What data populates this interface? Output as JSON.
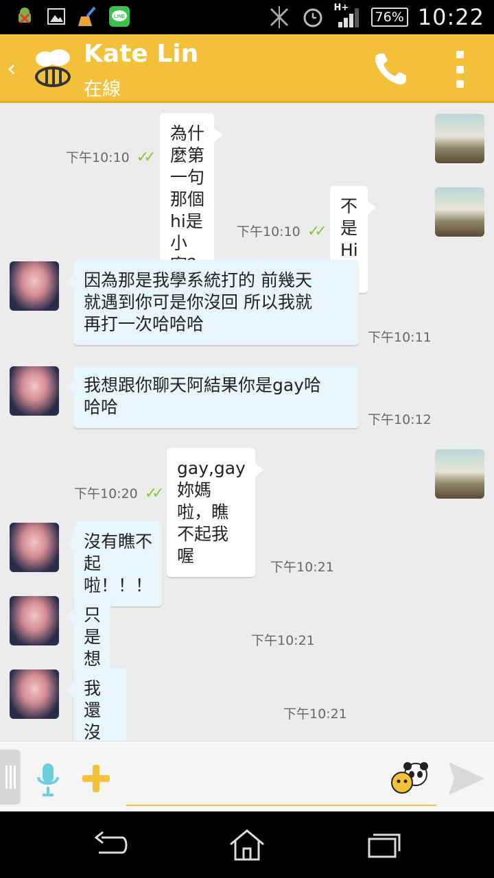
{
  "status_bar": {
    "icons": [
      "android-debug-icon",
      "image-icon",
      "broom-icon",
      "line-app-icon"
    ],
    "line_label": "LINE",
    "network": "H+",
    "battery": "76%",
    "time": "10:22"
  },
  "header": {
    "contact_name": "Kate Lin",
    "status": "在線",
    "accent": "#f3c13a"
  },
  "messages": [
    {
      "direction": "out",
      "text": "為什麼第一句那個hi是小寫？",
      "time": "下午10:10",
      "read": true
    },
    {
      "direction": "out",
      "text": "不是Hi嗎",
      "time": "下午10:10",
      "read": true
    },
    {
      "direction": "in",
      "lines": [
        "因為那是我學系統打的 前幾天",
        "就遇到你可是你沒回 所以我就",
        "再打一次哈哈哈"
      ],
      "time": "下午10:11"
    },
    {
      "direction": "in",
      "lines": [
        "我想跟你聊天阿結果你是gay哈",
        "哈哈"
      ],
      "time": "下午10:12"
    },
    {
      "direction": "out",
      "text": "gay,gay妳媽啦，瞧不起我喔",
      "time": "下午10:20",
      "read": true
    },
    {
      "direction": "in",
      "text": "沒有瞧不起啦！！！",
      "time": "下午10:21"
    },
    {
      "direction": "in",
      "text": "只是想聽你說而已",
      "time": "下午10:21"
    },
    {
      "direction": "in",
      "text": "我還沒有...這種朋友阿",
      "time": "下午10:21"
    }
  ],
  "input": {
    "value": "",
    "placeholder": ""
  }
}
